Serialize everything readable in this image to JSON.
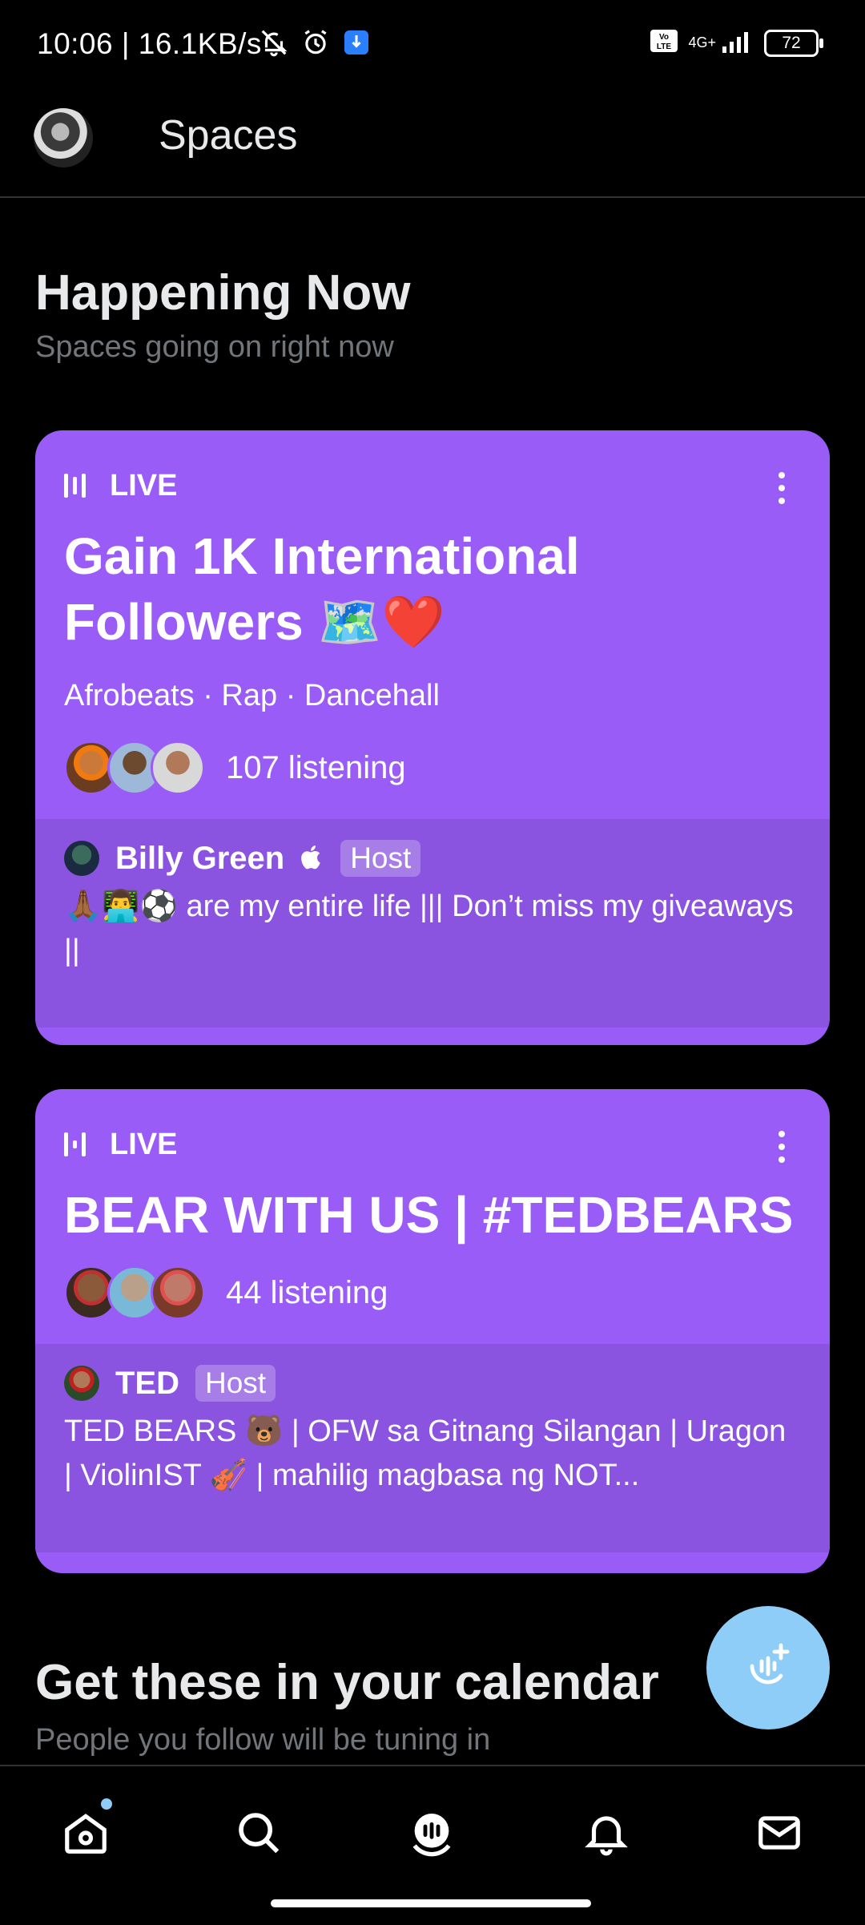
{
  "status_bar": {
    "time_speed": "10:06 | 16.1KB/s",
    "network": "4G+",
    "volte": "Vo LTE",
    "battery": "72"
  },
  "header": {
    "title": "Spaces"
  },
  "happening": {
    "title": "Happening Now",
    "subtitle": "Spaces going on right now"
  },
  "spaces": [
    {
      "live_label": "LIVE",
      "title": "Gain 1K International Followers 🗺️❤️",
      "topics": "Afrobeats · Rap · Dancehall",
      "listening": "107 listening",
      "host_name": "Billy Green ",
      "host_badge": "Host",
      "bio": "🙏🏾👨‍💻⚽ are my entire life ||| Don’t miss my giveaways ||"
    },
    {
      "live_label": "LIVE",
      "title": "BEAR WITH US | #TEDBEARS",
      "listening": "44 listening",
      "host_name": "TED",
      "host_badge": "Host",
      "bio": "TED BEARS 🐻 | OFW sa Gitnang Silangan | Uragon | ViolinIST 🎻 | mahilig magbasa ng NOT..."
    }
  ],
  "calendar": {
    "title": "Get these in your calendar",
    "subtitle": "People you follow will be tuning in"
  },
  "nav": [
    "home-icon",
    "search-icon",
    "spaces-icon",
    "notifications-icon",
    "messages-icon"
  ],
  "colors": {
    "card": "#9a5cf7",
    "card_footer": "#8a53e0",
    "fab": "#8ecdf7",
    "background": "#000000"
  }
}
